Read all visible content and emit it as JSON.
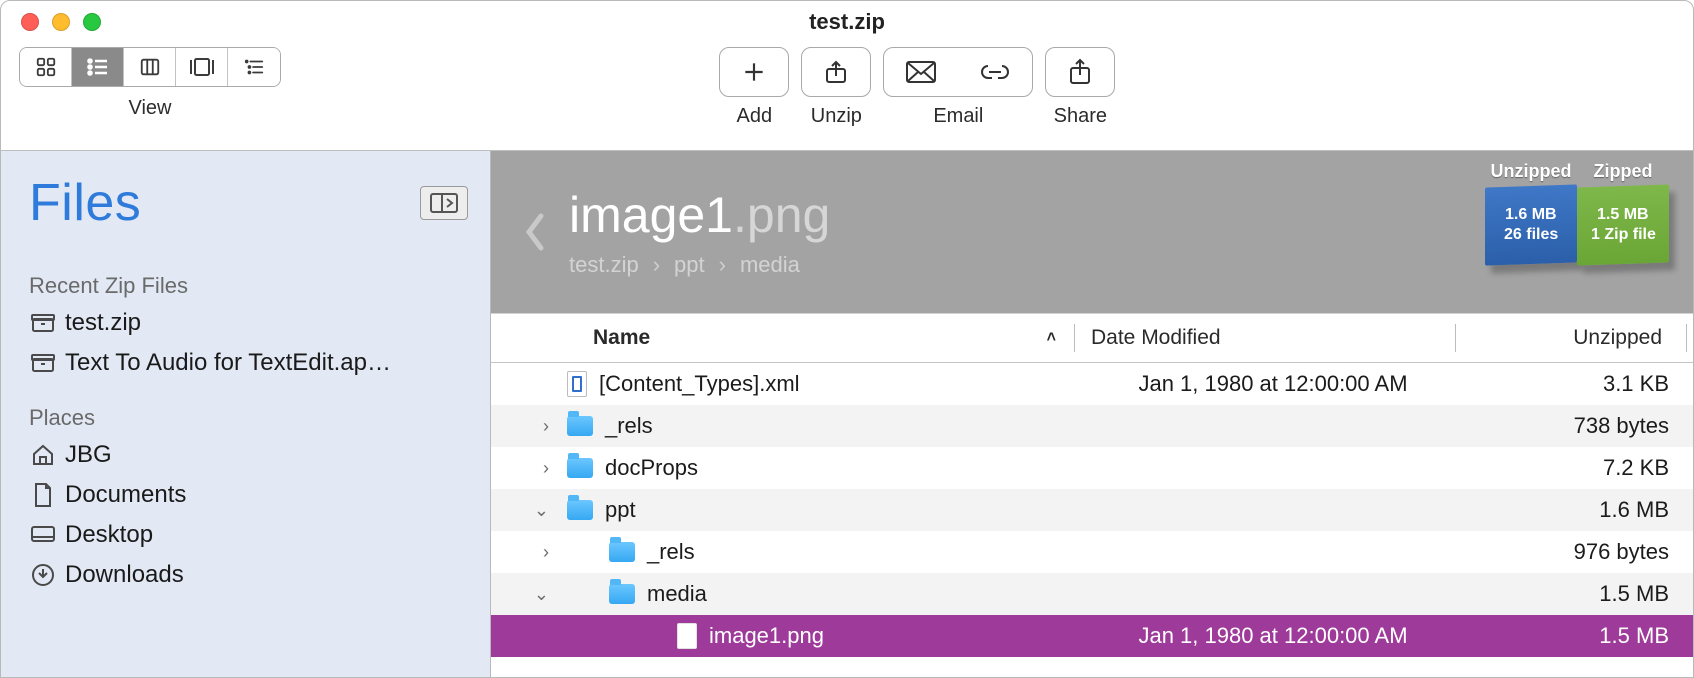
{
  "window": {
    "title": "test.zip"
  },
  "toolbar": {
    "view_label": "View",
    "add": "Add",
    "unzip": "Unzip",
    "email": "Email",
    "share": "Share"
  },
  "sidebar": {
    "title": "Files",
    "sections": {
      "recent": "Recent Zip Files",
      "places": "Places"
    },
    "recent_items": [
      {
        "label": "test.zip"
      },
      {
        "label": "Text To Audio for TextEdit.ap…"
      }
    ],
    "places_items": [
      {
        "label": "JBG"
      },
      {
        "label": "Documents"
      },
      {
        "label": "Desktop"
      },
      {
        "label": "Downloads"
      }
    ]
  },
  "header": {
    "filename_base": "image1",
    "filename_ext": ".png",
    "breadcrumb": [
      "test.zip",
      "ppt",
      "media"
    ],
    "unzipped_label": "Unzipped",
    "zipped_label": "Zipped",
    "unzipped_size": "1.6 MB",
    "unzipped_files": "26 files",
    "zipped_size": "1.5 MB",
    "zipped_files": "1 Zip file"
  },
  "columns": {
    "name": "Name",
    "date": "Date Modified",
    "size": "Unzipped"
  },
  "rows": [
    {
      "expand": "",
      "indent": 1,
      "icon": "file-xml",
      "name": "[Content_Types].xml",
      "date": "Jan 1, 1980 at 12:00:00 AM",
      "size": "3.1 KB",
      "alt": false,
      "sel": false
    },
    {
      "expand": "›",
      "indent": 1,
      "icon": "folder",
      "name": "_rels",
      "date": "",
      "size": "738 bytes",
      "alt": true,
      "sel": false
    },
    {
      "expand": "›",
      "indent": 1,
      "icon": "folder",
      "name": "docProps",
      "date": "",
      "size": "7.2 KB",
      "alt": false,
      "sel": false
    },
    {
      "expand": "⌄",
      "indent": 1,
      "icon": "folder",
      "name": "ppt",
      "date": "",
      "size": "1.6 MB",
      "alt": true,
      "sel": false
    },
    {
      "expand": "›",
      "indent": 2,
      "icon": "folder",
      "name": "_rels",
      "date": "",
      "size": "976 bytes",
      "alt": false,
      "sel": false
    },
    {
      "expand": "⌄",
      "indent": 2,
      "icon": "folder",
      "name": "media",
      "date": "",
      "size": "1.5 MB",
      "alt": true,
      "sel": false
    },
    {
      "expand": "",
      "indent": 3,
      "icon": "file",
      "name": "image1.png",
      "date": "Jan 1, 1980 at 12:00:00 AM",
      "size": "1.5 MB",
      "alt": false,
      "sel": true
    }
  ]
}
